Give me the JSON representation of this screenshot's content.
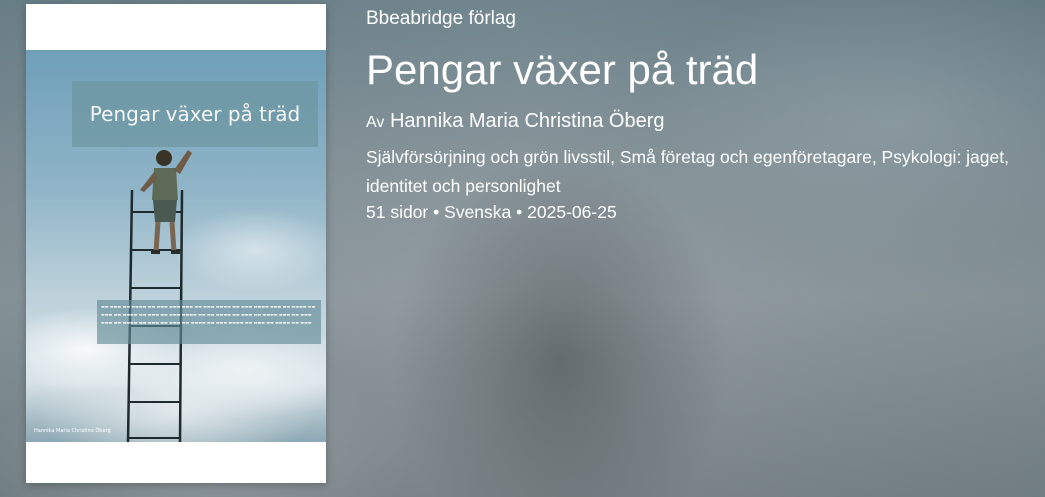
{
  "book": {
    "publisher": "Bbeabridge förlag",
    "title": "Pengar växer på träd",
    "author_prefix": "Av",
    "author": "Hannika Maria Christina Öberg",
    "categories": "Självförsörjning och grön livsstil, Små företag och egenföretagare, Psykologi: jaget, identitet och personlighet",
    "pages": "51 sidor",
    "language": "Svenska",
    "date": "2025-06-25",
    "separator": "•"
  },
  "cover": {
    "title": "Pengar växer på träd",
    "author": "Hannika Maria Christina Öberg"
  }
}
